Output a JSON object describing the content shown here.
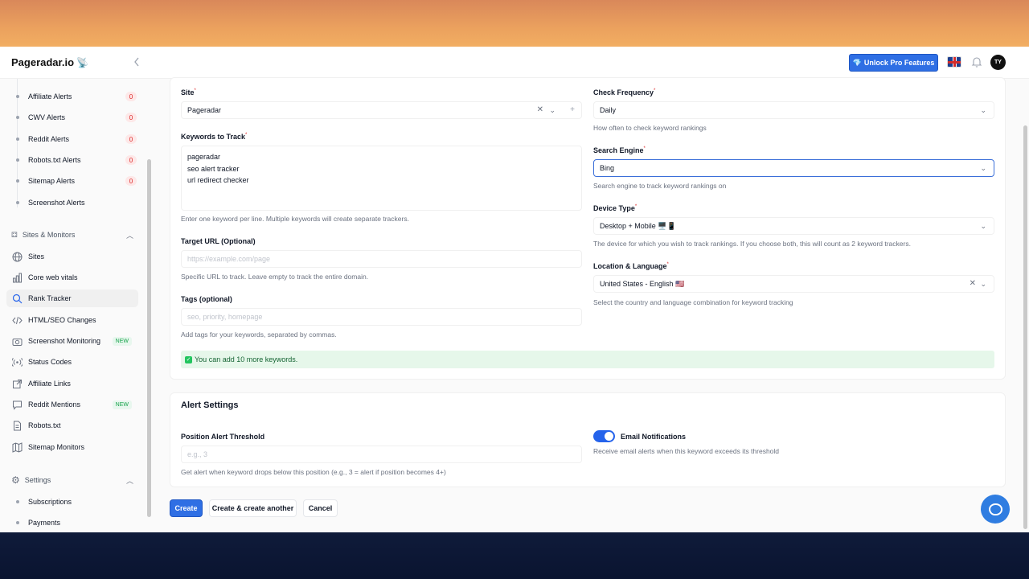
{
  "header": {
    "logo_text": "Pageradar.io",
    "logo_icon": "satellite-icon",
    "unlock_label": "Unlock Pro Features",
    "avatar_initials": "TY",
    "brand_color": "#2f6fe4"
  },
  "sidebar": {
    "alerts": [
      {
        "label": "Affiliate Alerts",
        "count": "0"
      },
      {
        "label": "CWV Alerts",
        "count": "0"
      },
      {
        "label": "Reddit Alerts",
        "count": "0"
      },
      {
        "label": "Robots.txt Alerts",
        "count": "0"
      },
      {
        "label": "Sitemap Alerts",
        "count": "0"
      },
      {
        "label": "Screenshot Alerts",
        "count": ""
      }
    ],
    "sites_group_label": "Sites & Monitors",
    "items": [
      {
        "label": "Sites",
        "icon": "globe-icon"
      },
      {
        "label": "Core web vitals",
        "icon": "bar-chart-icon"
      },
      {
        "label": "Rank Tracker",
        "icon": "search-icon",
        "active": true
      },
      {
        "label": "HTML/SEO Changes",
        "icon": "code-icon"
      },
      {
        "label": "Screenshot Monitoring",
        "icon": "camera-icon",
        "badge": "NEW"
      },
      {
        "label": "Status Codes",
        "icon": "signal-icon"
      },
      {
        "label": "Affiliate Links",
        "icon": "external-link-icon"
      },
      {
        "label": "Reddit Mentions",
        "icon": "chat-icon",
        "badge": "NEW"
      },
      {
        "label": "Robots.txt",
        "icon": "file-icon"
      },
      {
        "label": "Sitemap Monitors",
        "icon": "map-icon"
      }
    ],
    "settings_group_label": "Settings",
    "settings_items": [
      {
        "label": "Subscriptions"
      },
      {
        "label": "Payments"
      }
    ]
  },
  "form": {
    "site_label": "Site",
    "site_value": "Pageradar",
    "keywords_label": "Keywords to Track",
    "keywords": [
      "pageradar",
      "seo alert tracker",
      "url redirect checker"
    ],
    "keywords_help": "Enter one keyword per line. Multiple keywords will create separate trackers.",
    "target_url_label": "Target URL (Optional)",
    "target_url_placeholder": "https://example.com/page",
    "target_url_help": "Specific URL to track. Leave empty to track the entire domain.",
    "tags_label": "Tags (optional)",
    "tags_placeholder": "seo, priority, homepage",
    "tags_help": "Add tags for your keywords, separated by commas.",
    "check_frequency_label": "Check Frequency",
    "check_frequency_value": "Daily",
    "check_frequency_help": "How often to check keyword rankings",
    "search_engine_label": "Search Engine",
    "search_engine_value": "Bing",
    "search_engine_help": "Search engine to track keyword rankings on",
    "device_type_label": "Device Type",
    "device_type_value": "Desktop + Mobile 🖥️📱",
    "device_type_help": "The device for which you wish to track rankings. If you choose both, this will count as 2 keyword trackers.",
    "location_label": "Location & Language",
    "location_value": "United States - English 🇺🇸",
    "location_help": "Select the country and language combination for keyword tracking",
    "info_message": "You can add 10 more keywords."
  },
  "alert_settings": {
    "title": "Alert Settings",
    "threshold_label": "Position Alert Threshold",
    "threshold_placeholder": "e.g., 3",
    "threshold_help": "Get alert when keyword drops below this position (e.g., 3 = alert if position becomes 4+)",
    "email_label": "Email Notifications",
    "email_help": "Receive email alerts when this keyword exceeds its threshold",
    "email_enabled": true
  },
  "actions": {
    "create": "Create",
    "create_another": "Create & create another",
    "cancel": "Cancel"
  }
}
